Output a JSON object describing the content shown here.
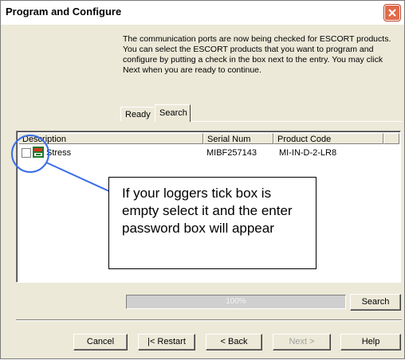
{
  "window": {
    "title": "Program and Configure"
  },
  "intro_text": "The communication ports are now being checked for ESCORT products. You can select the ESCORT products that you want to program and configure by putting a check in the box next to the entry. You may click Next when you are ready to continue.",
  "tabs": [
    {
      "label": "Ready"
    },
    {
      "label": "Search"
    }
  ],
  "list": {
    "columns": [
      "Description",
      "Serial Num",
      "Product Code"
    ],
    "rows": [
      {
        "description": "Stress",
        "serial": "MIBF257143",
        "product_code": "MI-IN-D-2-LR8",
        "checked": false,
        "icon": "logger-icon"
      }
    ]
  },
  "progress": {
    "value": 1.0,
    "label": "100%"
  },
  "buttons": {
    "search": "Search",
    "cancel": "Cancel",
    "restart": "|< Restart",
    "back": "< Back",
    "next": "Next >",
    "help": "Help"
  },
  "annotation": {
    "text": "If your loggers tick box is empty select it and the enter password box will appear",
    "color": "#3a6ee8"
  },
  "colors": {
    "close_button": "#e26a4a",
    "dialog_bg": "#ece9d8"
  }
}
